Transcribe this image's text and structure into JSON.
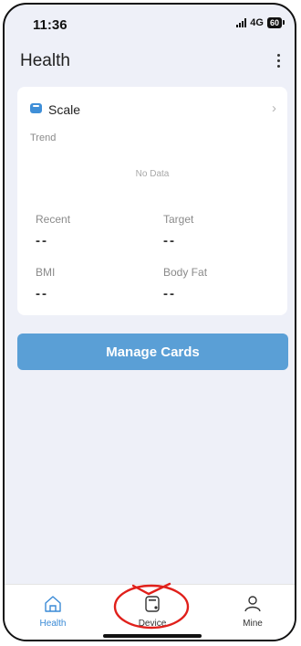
{
  "status_bar": {
    "time": "11:36",
    "network": "4G",
    "battery": "60"
  },
  "header": {
    "title": "Health",
    "menu_icon": "more-vertical-icon"
  },
  "scale_card": {
    "icon": "scale-icon",
    "title": "Scale",
    "trend_label": "Trend",
    "no_data": "No Data",
    "metrics": [
      {
        "label": "Recent",
        "value": "--"
      },
      {
        "label": "Target",
        "value": "--"
      },
      {
        "label": "BMI",
        "value": "--"
      },
      {
        "label": "Body Fat",
        "value": "--"
      }
    ]
  },
  "manage_button": {
    "label": "Manage Cards"
  },
  "tab_bar": {
    "tabs": [
      {
        "label": "Health",
        "icon": "home-icon",
        "active": true
      },
      {
        "label": "Device",
        "icon": "device-icon",
        "active": false
      },
      {
        "label": "Mine",
        "icon": "person-icon",
        "active": false
      }
    ]
  },
  "colors": {
    "accent": "#3a8ad6",
    "button": "#5a9fd6",
    "background": "#eef0f8",
    "annotation": "#e0201b"
  }
}
